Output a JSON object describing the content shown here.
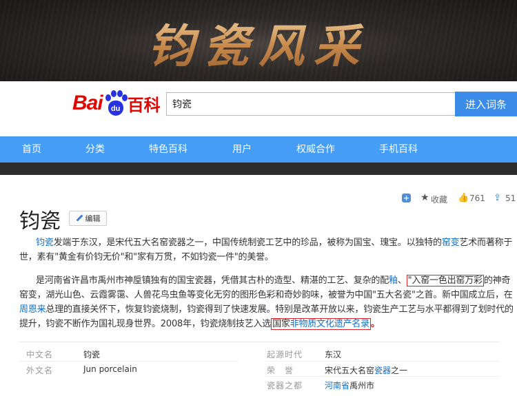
{
  "banner": {
    "title": "钧瓷风采"
  },
  "header": {
    "logo_bai": "Bai",
    "logo_du": "du",
    "logo_baike": "百科",
    "search_value": "钧瓷",
    "search_button": "进入词条"
  },
  "nav": {
    "items": [
      "首页",
      "分类",
      "特色百科",
      "用户",
      "权威合作",
      "手机百科"
    ]
  },
  "colors": {
    "nav_bg": "#459df5",
    "link": "#136ec2",
    "highlight_box": "#d6242a",
    "logo_red": "#e10602",
    "logo_blue": "#2932e1"
  },
  "tools": {
    "plus_icon": "+",
    "favorite_label": "收藏",
    "like_count": "761",
    "share_count": "51"
  },
  "article": {
    "title": "钧瓷",
    "edit_label": "编辑",
    "p1": {
      "l1_link": "钧瓷",
      "l1_text": "发端于东汉，是宋代五大名窑瓷器之一，中国传统制瓷工艺中的珍品，被称为国宝、瑰宝。以独特的",
      "l1_link2": "窑变",
      "l1_tail": "艺术而著称于",
      "l2": "世，素有\"黄金有价钧无价\"和\"家有万贯，不如钧瓷一件\"的美誉。"
    },
    "p2": {
      "l1_pre": "是河南省许昌市禹州市神垕镇独有的国宝瓷器，凭借其古朴的造型、精湛的工艺、复杂的配",
      "l1_link": "釉",
      "l1_mid": "、",
      "l1_boxed": "\"入窑一色出窑万彩",
      "l1_tail": "的神奇",
      "l2": "窑变，湖光山色、云霞雾霭、人兽花鸟虫鱼等变化无穷的图形色彩和奇妙韵味，被誉为中国\"五大名瓷\"之首。新中国成立后，在",
      "l3_link": "周恩来",
      "l3_text": "总理的直接关怀下，恢复钧瓷烧制，钧瓷得到了快速发展。特别是改革开放以来，钧瓷生产工艺与水平都得到了划时代的",
      "l4_pre": "提升，钧瓷不断作为国礼现身世界。2008年，钧瓷烧制技艺入选",
      "l4_boxed_pre": "国家",
      "l4_boxed_link": "非物质文化遗产名录",
      "l4_dot": "。"
    }
  },
  "infobox": {
    "left": [
      {
        "label": "中文名",
        "value": "钧瓷"
      },
      {
        "label": "外文名",
        "value": "Jun porcelain"
      }
    ],
    "right": [
      {
        "label": "起源时代",
        "value": "东汉"
      },
      {
        "label": "荣　誉",
        "value_pre": "宋代五大名窑",
        "value_link": "瓷器",
        "value_post": "之一"
      },
      {
        "label": "瓷器之都",
        "value_link": "河南省",
        "value_post": "禹州市"
      }
    ]
  }
}
